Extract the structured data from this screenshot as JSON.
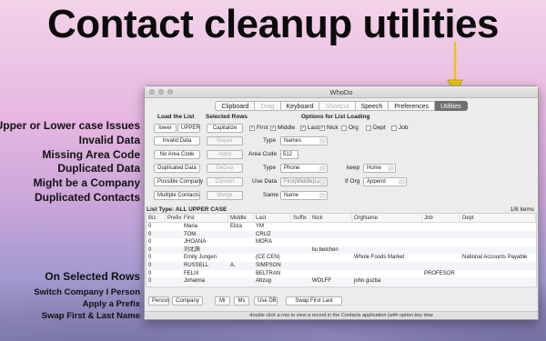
{
  "banner": "Contact cleanup utilities",
  "annotations": {
    "left": [
      "Upper or Lower case Issues",
      "Invalid Data",
      "Missing Area Code",
      "Duplicated Data",
      "Might be a Company",
      "Duplicated Contacts"
    ],
    "selected_heading": "On Selected Rows",
    "selected_items": [
      "Switch Company I Person",
      "Apply a Prefix",
      "Swap First & Last Name"
    ]
  },
  "window": {
    "title": "WhoDo",
    "tabs": [
      {
        "label": "Clipboard",
        "state": "normal"
      },
      {
        "label": "Drag",
        "state": "disabled"
      },
      {
        "label": "Keyboard",
        "state": "normal"
      },
      {
        "label": "Shortcut",
        "state": "disabled"
      },
      {
        "label": "Speech",
        "state": "normal"
      },
      {
        "label": "Preferences",
        "state": "normal"
      },
      {
        "label": "Utilities",
        "state": "active"
      }
    ],
    "headers": {
      "load_list": "Load the List",
      "selected_rows": "Selected Rows",
      "options": "Options for List Loading"
    },
    "buttons": {
      "lower": "lower",
      "upper": "UPPER",
      "capitalize": "Capitalize",
      "invalid_data": "Invalid Data",
      "repair": "Repair",
      "no_area_code": "No Area Code",
      "apply": "Apply",
      "duplicated_data": "Duplicated Data",
      "dedup": "DeDup",
      "possible_company": "Possible Company",
      "convert": "Convert",
      "multiple_contacts": "Multiple Contacts",
      "merge": "Merge"
    },
    "checkboxes": [
      {
        "label": "First",
        "checked": true
      },
      {
        "label": "Middle",
        "checked": true
      },
      {
        "label": "Last",
        "checked": true
      },
      {
        "label": "Nick",
        "checked": true
      },
      {
        "label": "Org",
        "checked": false
      },
      {
        "label": "Dept",
        "checked": false
      },
      {
        "label": "Job",
        "checked": false
      }
    ],
    "fields": {
      "type_label": "Type",
      "type_value": "Names",
      "area_code_label": "Area Code",
      "area_code_value": "512",
      "type2_label": "Type",
      "type2_value": "Phone",
      "keep_label": "keep",
      "keep_value": "Home",
      "use_data_label": "Use Data",
      "use_data_value": "First(Middle)Last",
      "if_org_label": "If Org",
      "if_org_value": "Append",
      "same_label": "Same",
      "same_value": "Name"
    },
    "list": {
      "type_text": "List Type:  ALL UPPER CASE",
      "count_text": "1/8 items",
      "columns": [
        "Biz",
        "Prefix",
        "First",
        "Middle",
        "Last",
        "Suffix",
        "Nick",
        "OrgName",
        "Job",
        "Dept"
      ],
      "rows": [
        [
          "0",
          "",
          "Maria",
          "Eliza",
          "YM",
          "",
          "",
          "",
          "",
          ""
        ],
        [
          "0",
          "",
          "TOM",
          "",
          "CRUZ",
          "",
          "",
          "",
          "",
          ""
        ],
        [
          "0",
          "",
          "JHOANA",
          "",
          "MORA",
          "",
          "",
          "",
          "",
          ""
        ],
        [
          "0",
          "",
          "刘北辰",
          "",
          "",
          "",
          "liu beichen",
          "",
          "",
          ""
        ],
        [
          "0",
          "",
          "Emily Jungen",
          "",
          "(CE CEN)",
          "",
          "",
          "Whole Foods Market",
          "",
          "National Accounts Payable"
        ],
        [
          "0",
          "",
          "RUSSELL",
          "A.",
          "SIMPSON",
          "",
          "",
          "",
          "",
          ""
        ],
        [
          "0",
          "",
          "FELIX",
          "",
          "BELTRAN",
          "",
          "",
          "",
          "PROFESOR",
          ""
        ],
        [
          "0",
          "",
          "Johanna",
          "",
          "Abzug",
          "",
          "WOLFF",
          "joho guzba",
          "",
          ""
        ]
      ]
    },
    "bottom_buttons": [
      "Person",
      "Company",
      "Mr",
      "Ms",
      "Use DB",
      "Swap First Last"
    ],
    "status": "double click a row to view a record in the Contacts application (with option key dow"
  }
}
